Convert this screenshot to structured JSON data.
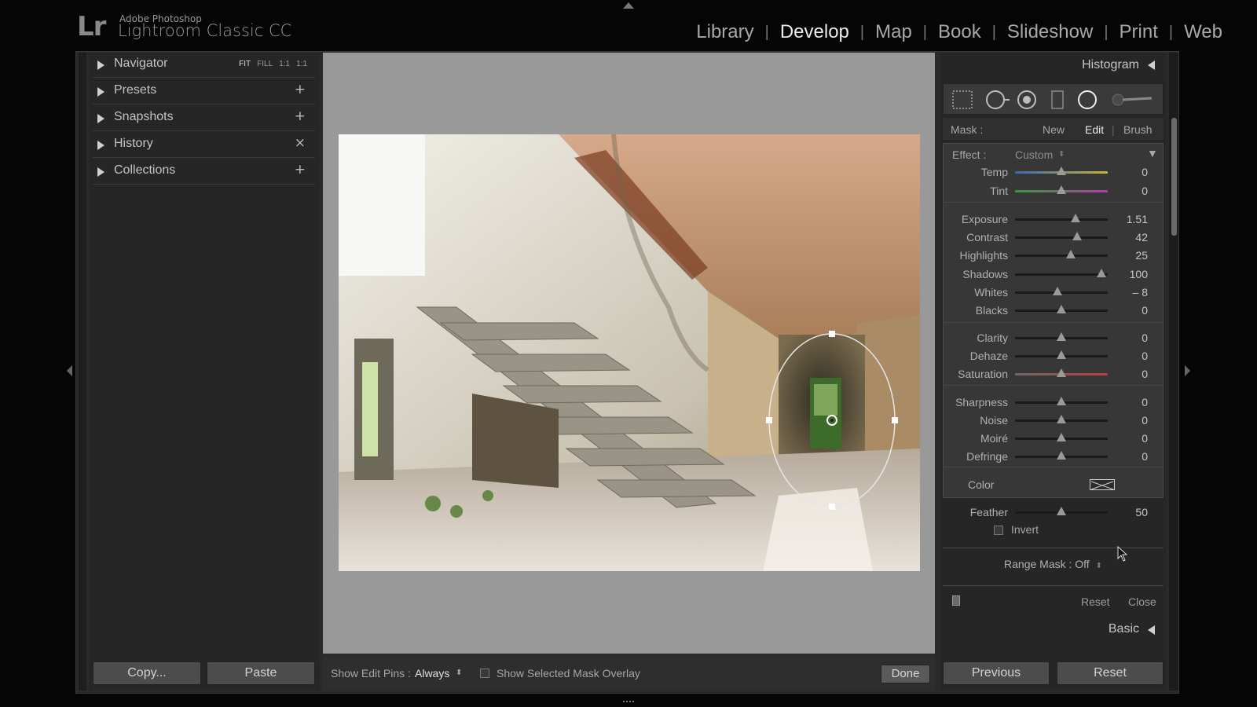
{
  "app": {
    "logo": "Lr",
    "vendor": "Adobe Photoshop",
    "product": "Lightroom Classic CC"
  },
  "modules": [
    {
      "label": "Library",
      "active": false
    },
    {
      "label": "Develop",
      "active": true
    },
    {
      "label": "Map",
      "active": false
    },
    {
      "label": "Book",
      "active": false
    },
    {
      "label": "Slideshow",
      "active": false
    },
    {
      "label": "Print",
      "active": false
    },
    {
      "label": "Web",
      "active": false
    }
  ],
  "left_panel": {
    "navigator": {
      "label": "Navigator",
      "zoom": [
        "FIT",
        "FILL",
        "1:1",
        "1:1"
      ]
    },
    "presets": {
      "label": "Presets",
      "action": "+"
    },
    "snapshots": {
      "label": "Snapshots",
      "action": "+"
    },
    "history": {
      "label": "History",
      "action": "×"
    },
    "collections": {
      "label": "Collections",
      "action": "+"
    },
    "copy_button": "Copy...",
    "paste_button": "Paste"
  },
  "toolbar": {
    "show_edit_pins_label": "Show Edit Pins :",
    "show_edit_pins_value": "Always",
    "show_mask_overlay_label": "Show Selected Mask Overlay",
    "done_button": "Done"
  },
  "right_panel": {
    "histogram_title": "Histogram",
    "mask": {
      "label": "Mask :",
      "new": "New",
      "edit": "Edit",
      "brush": "Brush"
    },
    "effect": {
      "label": "Effect :",
      "value": "Custom"
    },
    "sliders": [
      {
        "label": "Temp",
        "value": "0",
        "pos": 0.5
      },
      {
        "label": "Tint",
        "value": "0",
        "pos": 0.5
      },
      {
        "label": "Exposure",
        "value": "1.51",
        "pos": 0.65
      },
      {
        "label": "Contrast",
        "value": "42",
        "pos": 0.67
      },
      {
        "label": "Highlights",
        "value": "25",
        "pos": 0.6
      },
      {
        "label": "Shadows",
        "value": "100",
        "pos": 0.93
      },
      {
        "label": "Whites",
        "value": "– 8",
        "pos": 0.46
      },
      {
        "label": "Blacks",
        "value": "0",
        "pos": 0.5
      },
      {
        "label": "Clarity",
        "value": "0",
        "pos": 0.5
      },
      {
        "label": "Dehaze",
        "value": "0",
        "pos": 0.5
      },
      {
        "label": "Saturation",
        "value": "0",
        "pos": 0.5
      },
      {
        "label": "Sharpness",
        "value": "0",
        "pos": 0.5
      },
      {
        "label": "Noise",
        "value": "0",
        "pos": 0.5
      },
      {
        "label": "Moiré",
        "value": "0",
        "pos": 0.5
      },
      {
        "label": "Defringe",
        "value": "0",
        "pos": 0.5
      }
    ],
    "color_label": "Color",
    "feather": {
      "label": "Feather",
      "value": "50",
      "pos": 0.5
    },
    "invert_label": "Invert",
    "range_mask": "Range Mask : Off",
    "reset": "Reset",
    "close": "Close",
    "basic_title": "Basic",
    "previous_button": "Previous",
    "reset_button": "Reset"
  }
}
